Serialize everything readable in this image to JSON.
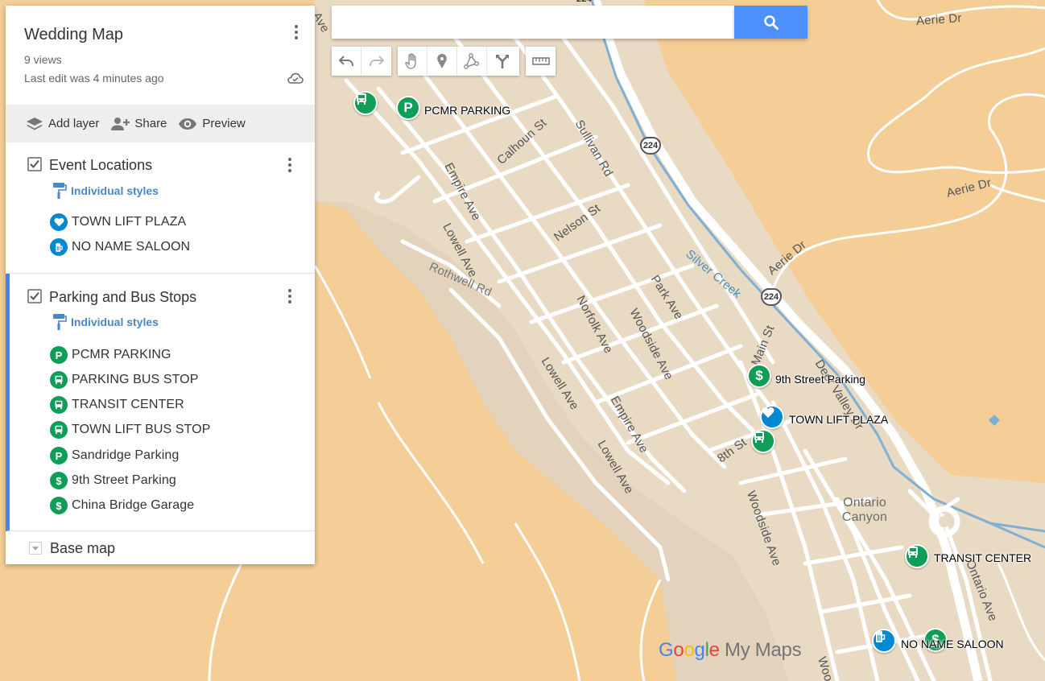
{
  "map": {
    "title": "Wedding Map",
    "views": "9 views",
    "last_edit": "Last edit was 4 minutes ago"
  },
  "actions": {
    "add_layer": "Add layer",
    "share": "Share",
    "preview": "Preview"
  },
  "search": {
    "placeholder": ""
  },
  "layers": [
    {
      "title": "Event Locations",
      "styles_label": "Individual styles",
      "checked": true,
      "features": [
        {
          "label": "TOWN LIFT PLAZA",
          "icon": "heart-icon",
          "color": "#0288d1"
        },
        {
          "label": "NO NAME SALOON",
          "icon": "beer-icon",
          "color": "#0288d1"
        }
      ]
    },
    {
      "title": "Parking and Bus Stops",
      "styles_label": "Individual styles",
      "checked": true,
      "features": [
        {
          "label": "PCMR PARKING",
          "icon": "parking-icon",
          "color": "#0f9d58"
        },
        {
          "label": "PARKING BUS STOP",
          "icon": "bus-icon",
          "color": "#0f9d58"
        },
        {
          "label": "TRANSIT CENTER",
          "icon": "bus-icon",
          "color": "#0f9d58"
        },
        {
          "label": "TOWN LIFT BUS STOP",
          "icon": "bus-icon",
          "color": "#0f9d58"
        },
        {
          "label": "Sandridge Parking",
          "icon": "parking-icon",
          "color": "#0f9d58"
        },
        {
          "label": "9th Street Parking",
          "icon": "dollar-icon",
          "color": "#0f9d58"
        },
        {
          "label": "China Bridge Garage",
          "icon": "dollar-icon",
          "color": "#0f9d58"
        }
      ]
    }
  ],
  "base_map_label": "Base map",
  "map_pins": [
    {
      "label": "PCMR PARKING",
      "icon": "parking-icon"
    },
    {
      "label": "9th Street Parking",
      "icon": "dollar-icon"
    },
    {
      "label": "TOWN LIFT PLAZA",
      "icon": "heart-icon"
    },
    {
      "label": "TRANSIT CENTER",
      "icon": "bus-icon"
    },
    {
      "label": "NO NAME SALOON",
      "icon": "beer-icon"
    },
    {
      "label": "",
      "icon": "bus-icon"
    },
    {
      "label": "",
      "icon": "bus-icon"
    },
    {
      "label": "",
      "icon": "dollar-icon"
    }
  ],
  "streets": {
    "aerie_1": "Aerie Dr",
    "aerie_2": "Aerie Dr",
    "aerie_3": "Aerie Dr",
    "calhoun": "Calhoun St",
    "sullivan": "Sullivan Rd",
    "empire_1": "Empire Ave",
    "lowell_1": "Lowell Ave",
    "rothwell": "Rothwell Rd",
    "nelson": "Nelson St",
    "norfolk": "Norfolk Ave",
    "woodside_1": "Woodside Ave",
    "park": "Park Ave",
    "silver_creek": "Silver Creek",
    "main": "Main St",
    "deer_valley": "Deer Valley Dr",
    "lowell_2": "Lowell Ave",
    "empire_2": "Empire Ave",
    "lowell_3": "Lowell Ave",
    "eighth": "8th St",
    "woodside_2": "Woodside Ave",
    "ontario_canyon": "Ontario Canyon",
    "ontario_ave": "Ontario Ave",
    "top_ave": "Ave",
    "woodside_3": "Wood",
    "partial_top": "224"
  },
  "shields": [
    "224",
    "224"
  ],
  "watermark": {
    "google": "Google",
    "my_maps": "My Maps"
  },
  "colors": {
    "land": "#f4cd97",
    "urban": "#e9dac4",
    "road": "#ffffff",
    "water": "#7fb0d4",
    "pin_green": "#0f9d58",
    "pin_blue": "#0288d1",
    "search_button": "#4d90fe",
    "link": "#4a86c8",
    "active_layer": "#4285f4"
  }
}
